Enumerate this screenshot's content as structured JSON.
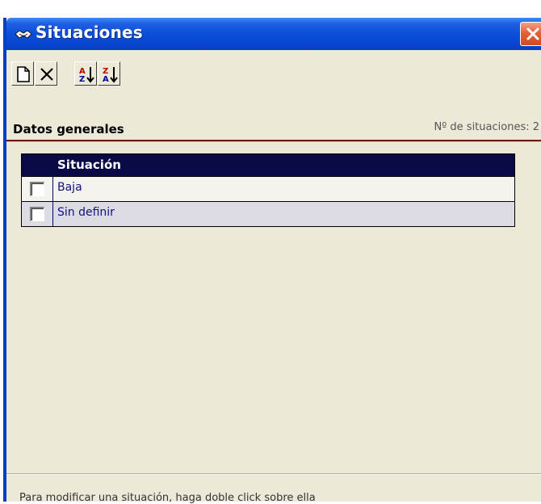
{
  "window": {
    "title": "Situaciones",
    "title_icon": "handshake-icon",
    "close_icon": "close-icon"
  },
  "toolbar": {
    "buttons": [
      {
        "name": "new-button",
        "icon": "new-document-icon"
      },
      {
        "name": "delete-button",
        "icon": "delete-x-icon"
      },
      {
        "name": "sort-ascending-button",
        "icon": "sort-a-z-icon"
      },
      {
        "name": "sort-descending-button",
        "icon": "sort-z-a-icon"
      }
    ]
  },
  "section": {
    "title": "Datos generales",
    "count_text": "Nº de situaciones: 2"
  },
  "grid": {
    "column_header": "Situación",
    "rows": [
      {
        "label": "Baja",
        "checked": false
      },
      {
        "label": "Sin definir",
        "checked": false
      }
    ]
  },
  "status": {
    "hint": "Para modificar una situación, haga doble click sobre ella"
  },
  "colors": {
    "titlebar": "#0b4fd8",
    "grid_header": "#0a0a46",
    "section_rule": "#6b1a14",
    "window_bg": "#ece9d8"
  }
}
